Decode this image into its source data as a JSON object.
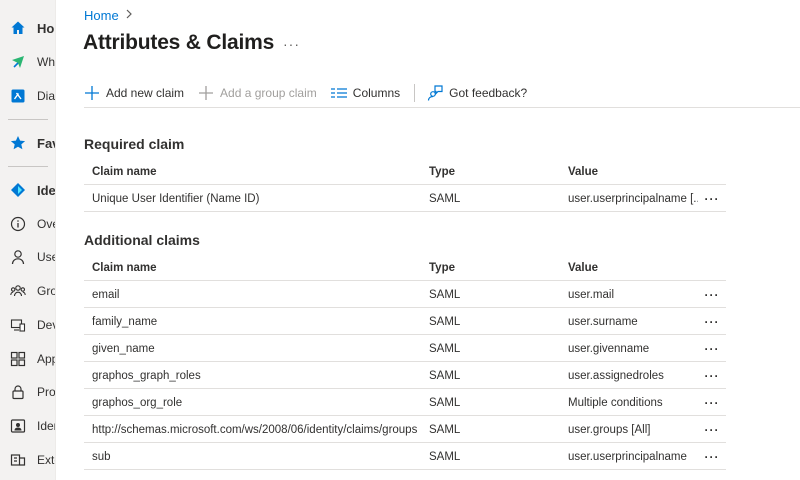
{
  "sidebar": {
    "items": [
      {
        "label": "Home",
        "icon": "home-icon"
      },
      {
        "label": "What's new",
        "icon": "whats-new-icon"
      },
      {
        "label": "Diagnose & solve problems",
        "icon": "diagnose-icon"
      },
      {
        "label": "Favorites",
        "icon": "star-icon"
      },
      {
        "label": "Identity",
        "icon": "identity-icon"
      },
      {
        "label": "Overview",
        "icon": "info-icon"
      },
      {
        "label": "Users",
        "icon": "user-icon"
      },
      {
        "label": "Groups",
        "icon": "groups-icon"
      },
      {
        "label": "Devices",
        "icon": "devices-icon"
      },
      {
        "label": "Applications",
        "icon": "apps-icon"
      },
      {
        "label": "Protection",
        "icon": "lock-icon"
      },
      {
        "label": "Identity governance",
        "icon": "governance-icon"
      },
      {
        "label": "External identities",
        "icon": "external-icon"
      }
    ]
  },
  "breadcrumb": {
    "home": "Home",
    "separator": ">"
  },
  "page": {
    "title": "Attributes & Claims",
    "more": "···"
  },
  "toolbar": {
    "add_claim": "Add new claim",
    "add_group_claim": "Add a group claim",
    "columns": "Columns",
    "feedback": "Got feedback?"
  },
  "required": {
    "title": "Required claim",
    "headers": {
      "name": "Claim name",
      "type": "Type",
      "value": "Value"
    },
    "rows": [
      {
        "name": "Unique User Identifier (Name ID)",
        "type": "SAML",
        "value": "user.userprincipalname [..."
      }
    ]
  },
  "additional": {
    "title": "Additional claims",
    "headers": {
      "name": "Claim name",
      "type": "Type",
      "value": "Value"
    },
    "rows": [
      {
        "name": "email",
        "type": "SAML",
        "value": "user.mail"
      },
      {
        "name": "family_name",
        "type": "SAML",
        "value": "user.surname"
      },
      {
        "name": "given_name",
        "type": "SAML",
        "value": "user.givenname"
      },
      {
        "name": "graphos_graph_roles",
        "type": "SAML",
        "value": "user.assignedroles"
      },
      {
        "name": "graphos_org_role",
        "type": "SAML",
        "value": "Multiple conditions"
      },
      {
        "name": "http://schemas.microsoft.com/ws/2008/06/identity/claims/groups",
        "type": "SAML",
        "value": "user.groups [All]"
      },
      {
        "name": "sub",
        "type": "SAML",
        "value": "user.userprincipalname"
      }
    ]
  },
  "row_more": "···",
  "colors": {
    "accent": "#0078d4",
    "sidebar_bg": "#f3f2f1",
    "border": "#e1dfdd"
  }
}
